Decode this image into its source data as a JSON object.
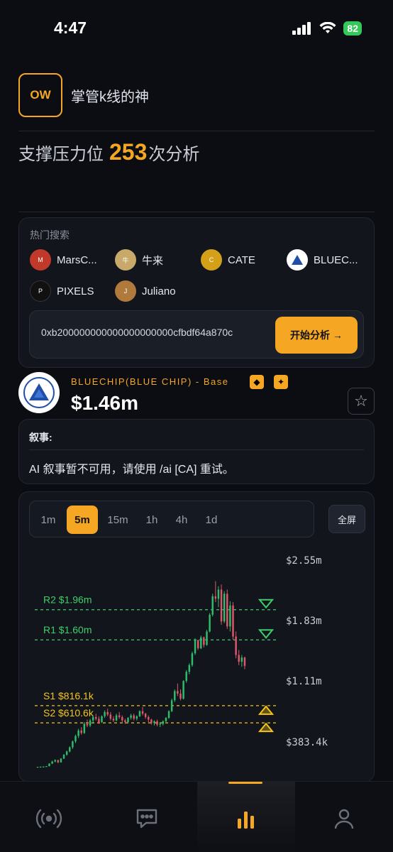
{
  "status": {
    "time": "4:47",
    "battery": "82"
  },
  "header": {
    "logo_text": "OW",
    "title": "掌管k线的神"
  },
  "analysis": {
    "prefix": "支撑压力位",
    "count": "253",
    "suffix": "次分析"
  },
  "hot": {
    "title": "热门搜索",
    "items": [
      {
        "label": "MarsC...",
        "icon": "mars-coin-icon",
        "color": "#c0392b"
      },
      {
        "label": "牛来",
        "icon": "bull-coin-icon",
        "color": "#c8a96a"
      },
      {
        "label": "CATE",
        "icon": "cate-coin-icon",
        "color": "#d4a017"
      },
      {
        "label": "BLUEC...",
        "icon": "bluechip-coin-icon",
        "color": "#ffffff"
      },
      {
        "label": "PIXELS",
        "icon": "pixels-coin-icon",
        "color": "#111111"
      },
      {
        "label": "Juliano",
        "icon": "juliano-coin-icon",
        "color": "#b07a3c"
      }
    ]
  },
  "search": {
    "value": "0xb200000000000000000000cfbdf64a870c",
    "button": "开始分析 →"
  },
  "token": {
    "name": "BLUECHIP(BLUE CHIP) - Base",
    "price": "$1.46m"
  },
  "narrative": {
    "title": "叙事:",
    "text": "AI 叙事暂不可用，请使用 /ai [CA] 重试。"
  },
  "chart": {
    "timeframes": [
      "1m",
      "5m",
      "15m",
      "1h",
      "4h",
      "1d"
    ],
    "active_timeframe": "5m",
    "fullscreen": "全屏"
  },
  "chart_data": {
    "type": "candlestick",
    "y_axis_labels": [
      "$2.55m",
      "$1.83m",
      "$1.11m",
      "$383.4k"
    ],
    "y_axis_values": [
      2550000,
      1830000,
      1110000,
      383400
    ],
    "levels": [
      {
        "name": "R2",
        "label": "$1.96m",
        "value": 1960000,
        "kind": "resistance"
      },
      {
        "name": "R1",
        "label": "$1.60m",
        "value": 1600000,
        "kind": "resistance"
      },
      {
        "name": "S1",
        "label": "$816.1k",
        "value": 816100,
        "kind": "support"
      },
      {
        "name": "S2",
        "label": "$610.6k",
        "value": 610600,
        "kind": "support"
      }
    ],
    "candles": [
      [
        85,
        88,
        82,
        87
      ],
      [
        87,
        90,
        85,
        89
      ],
      [
        89,
        92,
        87,
        90
      ],
      [
        90,
        96,
        89,
        95
      ],
      [
        95,
        130,
        93,
        125
      ],
      [
        125,
        160,
        120,
        150
      ],
      [
        150,
        175,
        140,
        168
      ],
      [
        168,
        170,
        130,
        140
      ],
      [
        140,
        190,
        138,
        185
      ],
      [
        185,
        240,
        180,
        230
      ],
      [
        230,
        280,
        220,
        270
      ],
      [
        270,
        330,
        260,
        320
      ],
      [
        320,
        400,
        300,
        390
      ],
      [
        390,
        470,
        370,
        455
      ],
      [
        455,
        540,
        430,
        520
      ],
      [
        520,
        560,
        470,
        490
      ],
      [
        490,
        620,
        480,
        600
      ],
      [
        600,
        650,
        560,
        580
      ],
      [
        580,
        660,
        560,
        640
      ],
      [
        640,
        700,
        610,
        680
      ],
      [
        680,
        720,
        640,
        660
      ],
      [
        660,
        690,
        600,
        620
      ],
      [
        620,
        700,
        610,
        690
      ],
      [
        690,
        760,
        670,
        740
      ],
      [
        740,
        780,
        690,
        710
      ],
      [
        710,
        740,
        640,
        660
      ],
      [
        660,
        690,
        620,
        640
      ],
      [
        640,
        720,
        630,
        700
      ],
      [
        700,
        740,
        660,
        680
      ],
      [
        680,
        700,
        620,
        640
      ],
      [
        640,
        660,
        600,
        620
      ],
      [
        620,
        680,
        610,
        670
      ],
      [
        670,
        720,
        650,
        700
      ],
      [
        700,
        720,
        640,
        660
      ],
      [
        660,
        700,
        640,
        690
      ],
      [
        690,
        760,
        680,
        750
      ],
      [
        750,
        800,
        700,
        720
      ],
      [
        720,
        730,
        660,
        680
      ],
      [
        680,
        700,
        620,
        650
      ],
      [
        650,
        660,
        590,
        610
      ],
      [
        610,
        640,
        580,
        630
      ],
      [
        630,
        650,
        570,
        590
      ],
      [
        590,
        620,
        560,
        600
      ],
      [
        600,
        640,
        580,
        630
      ],
      [
        630,
        680,
        620,
        670
      ],
      [
        670,
        760,
        660,
        750
      ],
      [
        750,
        900,
        740,
        880
      ],
      [
        880,
        1010,
        860,
        990
      ],
      [
        990,
        1080,
        930,
        960
      ],
      [
        960,
        1010,
        880,
        900
      ],
      [
        900,
        1120,
        890,
        1110
      ],
      [
        1110,
        1240,
        1090,
        1220
      ],
      [
        1220,
        1320,
        1190,
        1300
      ],
      [
        1300,
        1460,
        1280,
        1440
      ],
      [
        1440,
        1620,
        1420,
        1600
      ],
      [
        1600,
        1560,
        1480,
        1500
      ],
      [
        1500,
        1650,
        1490,
        1630
      ],
      [
        1630,
        1640,
        1510,
        1540
      ],
      [
        1540,
        1720,
        1530,
        1700
      ],
      [
        1700,
        1920,
        1690,
        1900
      ],
      [
        1900,
        2150,
        1880,
        2120
      ],
      [
        2120,
        2300,
        2050,
        2090
      ],
      [
        2090,
        2240,
        1990,
        2200
      ],
      [
        2200,
        2260,
        1780,
        1820
      ],
      [
        1820,
        2180,
        1800,
        2150
      ],
      [
        2150,
        2200,
        1730,
        1760
      ],
      [
        1760,
        2060,
        1700,
        2010
      ],
      [
        2010,
        2050,
        1600,
        1640
      ],
      [
        1640,
        1700,
        1380,
        1420
      ],
      [
        1420,
        1480,
        1300,
        1340
      ],
      [
        1340,
        1420,
        1280,
        1390
      ],
      [
        1390,
        1400,
        1250,
        1290
      ]
    ],
    "candle_unit": "thousand USD"
  }
}
